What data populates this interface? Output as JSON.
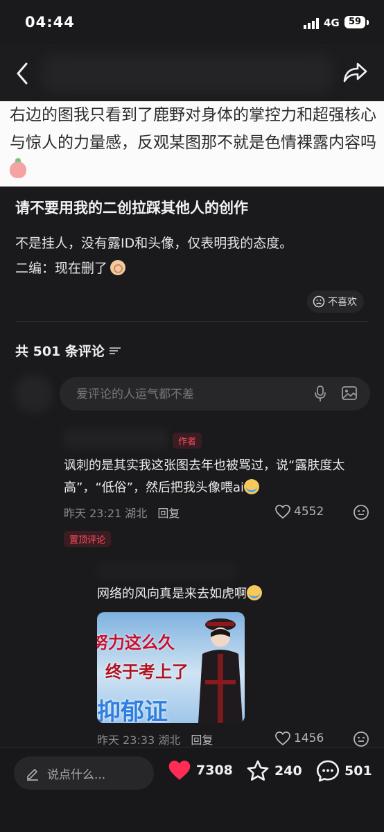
{
  "status_bar": {
    "time": "04:44",
    "network": "4G",
    "battery": "59"
  },
  "post": {
    "image_text": "右边的图我只看到了鹿野对身体的掌控力和超强核心与惊人的力量感，反观某图那不就是色情裸露内容吗",
    "title": "请不要用我的二创拉踩其他人的创作",
    "body_line1": "不是挂人，没有露ID和头像，仅表明我的态度。",
    "body_line2": "二编：现在删了",
    "dislike_label": "不喜欢"
  },
  "comments_header": {
    "count_label": "共 501 条评论"
  },
  "comment_input": {
    "placeholder": "爱评论的人运气都不差"
  },
  "comments": [
    {
      "tag": "作者",
      "text": "讽刺的是其实我这张图去年也被骂过，说“露肤度太高”，“低俗”，然后把我头像喂ai",
      "time": "昨天 23:21",
      "location": "湖北",
      "reply": "回复",
      "likes": "4552"
    },
    {
      "tag": "置顶评论",
      "text": "网络的风向真是来去如虎啊",
      "image_text": [
        "努力这么久",
        "终于考上了",
        "抑郁证"
      ],
      "time": "昨天 23:33",
      "location": "湖北",
      "reply": "回复",
      "likes": "1456"
    }
  ],
  "bottom_bar": {
    "say_placeholder": "说点什么...",
    "likes": "7308",
    "stars": "240",
    "comments": "501"
  },
  "colors": {
    "background": "#1a1a1c",
    "accent_red": "#ff4d5e",
    "heart": "#ff2d55"
  }
}
